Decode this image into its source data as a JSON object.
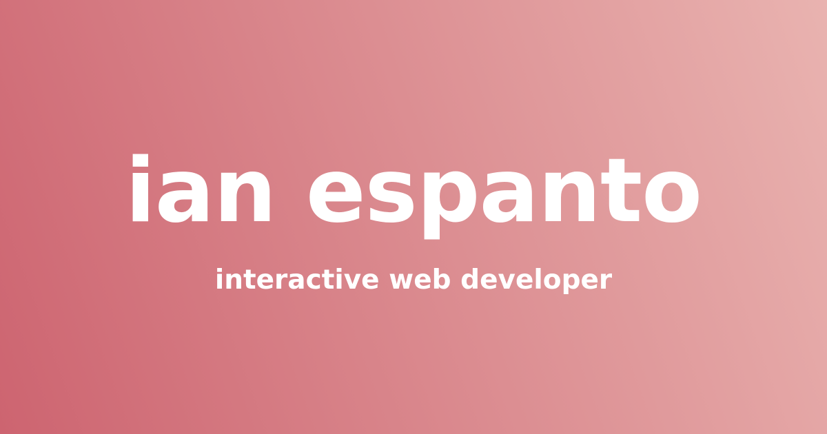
{
  "card": {
    "name": "ian espanto",
    "tagline": "interactive web developer"
  },
  "colors": {
    "gradient_start": "#cd6470",
    "gradient_end": "#e9b3b0",
    "text": "#ffffff"
  }
}
